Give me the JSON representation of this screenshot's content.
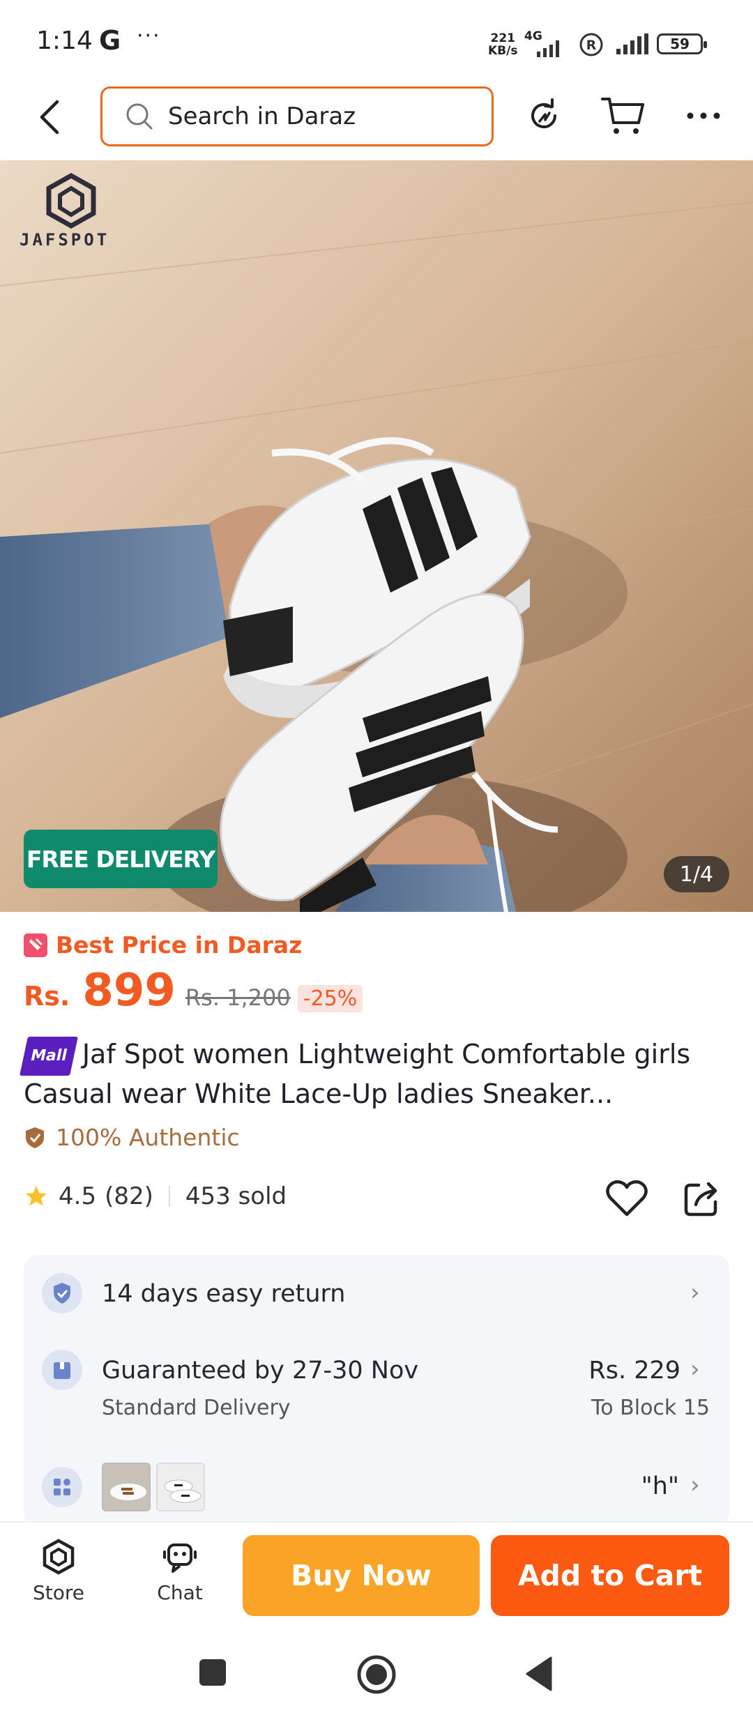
{
  "status_bar": {
    "time": "1:14",
    "g_icon": "G",
    "more": "···",
    "speed_value": "221",
    "speed_unit": "KB/s",
    "network": "4G",
    "battery": "59"
  },
  "header": {
    "search_placeholder": "Search in Daraz"
  },
  "gallery": {
    "brand_logo_text": "JAFSPOT",
    "free_delivery": "FREE DELIVERY",
    "image_counter": "1/4"
  },
  "product": {
    "best_price_label": "Best Price in Daraz",
    "currency": "Rs.",
    "price": "899",
    "original_price": "Rs. 1,200",
    "discount": "-25%",
    "mall_badge": "Mall",
    "title": "Jaf Spot women Lightweight Comfortable girls Casual wear White Lace-Up ladies Sneaker...",
    "authentic": "100% Authentic",
    "rating": "4.5",
    "reviews": "(82)",
    "sold": "453 sold"
  },
  "services": {
    "return_label": "14 days easy return",
    "delivery_label": "Guaranteed by 27-30 Nov",
    "delivery_type": "Standard Delivery",
    "delivery_price": "Rs. 229",
    "delivery_location": "To Block 15",
    "variant_value": "\"h\""
  },
  "bottom_bar": {
    "store_label": "Store",
    "chat_label": "Chat",
    "buy_now": "Buy Now",
    "add_to_cart": "Add to Cart"
  },
  "colors": {
    "accent_orange": "#f15a22",
    "buy_now": "#fba326",
    "add_to_cart": "#fc5a11",
    "free_delivery": "#0f8a6a"
  }
}
